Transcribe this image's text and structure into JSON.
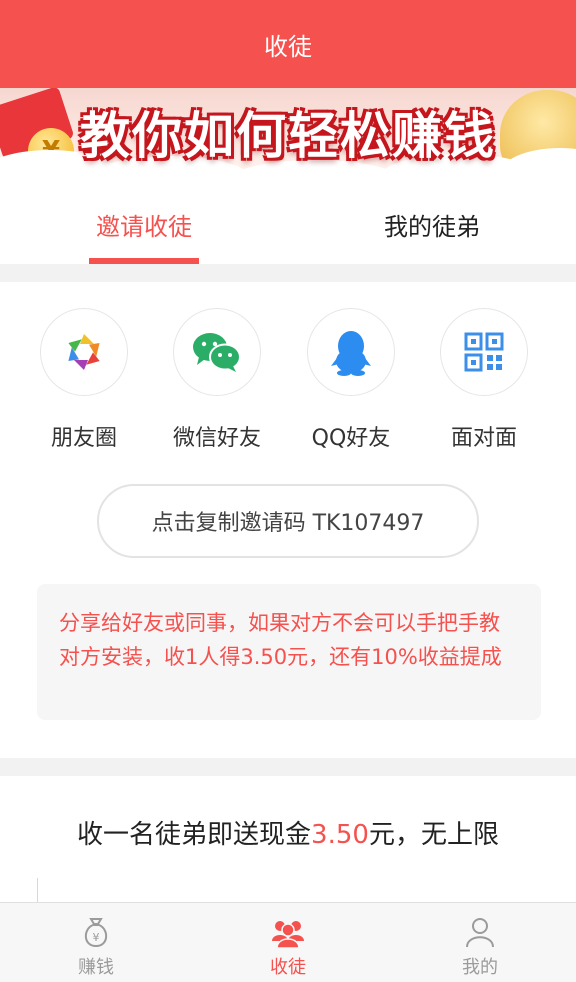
{
  "header": {
    "title": "收徒"
  },
  "banner": {
    "title": "教你如何轻松赚钱",
    "coin_symbol": "¥"
  },
  "tabs": [
    {
      "label": "邀请收徒",
      "active": true
    },
    {
      "label": "我的徒弟",
      "active": false
    }
  ],
  "share": {
    "items": [
      {
        "label": "朋友圈",
        "icon": "moments-icon"
      },
      {
        "label": "微信好友",
        "icon": "wechat-icon"
      },
      {
        "label": "QQ好友",
        "icon": "qq-icon"
      },
      {
        "label": "面对面",
        "icon": "qr-code-icon"
      }
    ],
    "copy_button": "点击复制邀请码 TK107497",
    "notice": "分享给好友或同事，如果对方不会可以手把手教对方安装，收1人得3.50元，还有10%收益提成"
  },
  "reward": {
    "prefix": "收一名徒弟即送现金",
    "amount": "3.50",
    "suffix": "元，无上限"
  },
  "bottom_nav": [
    {
      "label": "赚钱",
      "icon": "money-bag-icon",
      "active": false
    },
    {
      "label": "收徒",
      "icon": "people-icon",
      "active": true
    },
    {
      "label": "我的",
      "icon": "user-icon",
      "active": false
    }
  ],
  "colors": {
    "accent": "#f5514e",
    "wechat_green": "#2aae67",
    "qq_blue": "#2d8cf0",
    "qr_blue": "#3b8fe8"
  }
}
